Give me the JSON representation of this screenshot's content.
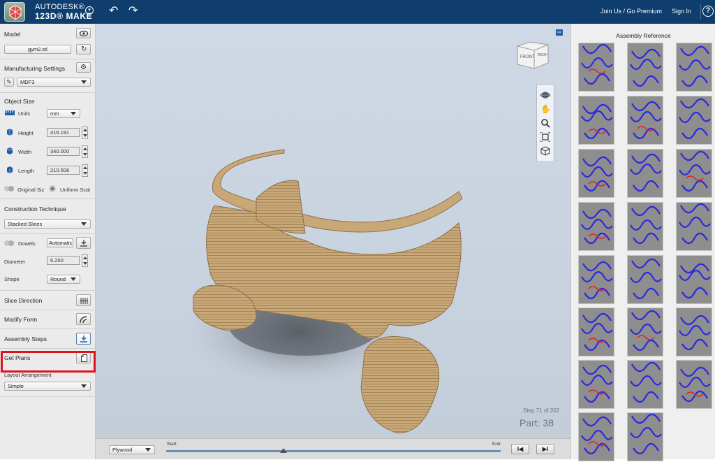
{
  "app": {
    "brand_line1": "AUTODESK®",
    "brand_line2": "123D® MAKE",
    "links": [
      "Join Us / Go Premium",
      "Sign In"
    ],
    "icons": [
      "logo-icon",
      "undo-icon",
      "redo-icon",
      "help-icon"
    ]
  },
  "left": {
    "model_title": "Model",
    "model_file": "gym2.stl",
    "manufacturing_title": "Manufacturing Settings",
    "material": "MDF3",
    "object_size_title": "Object Size",
    "units_label": "Units",
    "units_value": "mm",
    "height_label": "Height",
    "height_value": "416.191",
    "width_label": "Width",
    "width_value": "340.000",
    "length_label": "Length",
    "length_value": "210.508",
    "original_size": "Original Siz",
    "uniform_scale": "Uniform Scal",
    "construction_title": "Construction Technique",
    "technique_value": "Stacked Slices",
    "dowels_label": "Dowels",
    "dowels_value": "Automatic",
    "diameter_label": "Diameter",
    "diameter_value": "6.250",
    "shape_label": "Shape",
    "shape_value": "Round",
    "slice_direction": "Slice Direction",
    "modify_form": "Modify Form",
    "assembly_steps": "Assembly Steps",
    "get_plans": "Get Plans",
    "layout_title": "Layout Arrangement",
    "layout_value": "Simple"
  },
  "viewport": {
    "viewcube_front": "FRONT",
    "viewcube_right": "RIGHT",
    "step_text": "Step 71 of 202",
    "part_text": "Part: 38"
  },
  "bottom": {
    "material_select": "Plywood",
    "start_label": "Start",
    "end_label": "End",
    "prev_label": "I◀",
    "next_label": "▶I",
    "progress": 0.35
  },
  "right": {
    "title": "Assembly Reference"
  },
  "colors": {
    "topbar": "#0f3d6e",
    "highlight": "#e3101d",
    "wood": "#c8a676",
    "thumb_line": "#2a2ae0"
  }
}
